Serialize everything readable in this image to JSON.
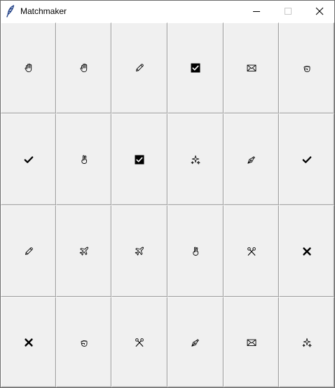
{
  "window": {
    "title": "Matchmaker",
    "icon": "feather-icon",
    "controls": [
      "minimize",
      "maximize",
      "close"
    ]
  },
  "board": {
    "rows": [
      [
        "raised-hand-icon",
        "raised-hand-icon",
        "pencil-icon",
        "checkbox-checked-icon",
        "envelope-icon",
        "fist-icon"
      ],
      [
        "check-mark-icon",
        "victory-hand-icon",
        "checkbox-checked-icon",
        "sparkles-icon",
        "pen-nib-icon",
        "check-mark-icon"
      ],
      [
        "pencil-icon",
        "airplane-icon",
        "airplane-icon",
        "victory-hand-icon",
        "scissors-icon",
        "cross-mark-icon"
      ],
      [
        "cross-mark-icon",
        "fist-icon",
        "scissors-icon",
        "pen-nib-icon",
        "envelope-icon",
        "sparkles-icon"
      ]
    ]
  }
}
